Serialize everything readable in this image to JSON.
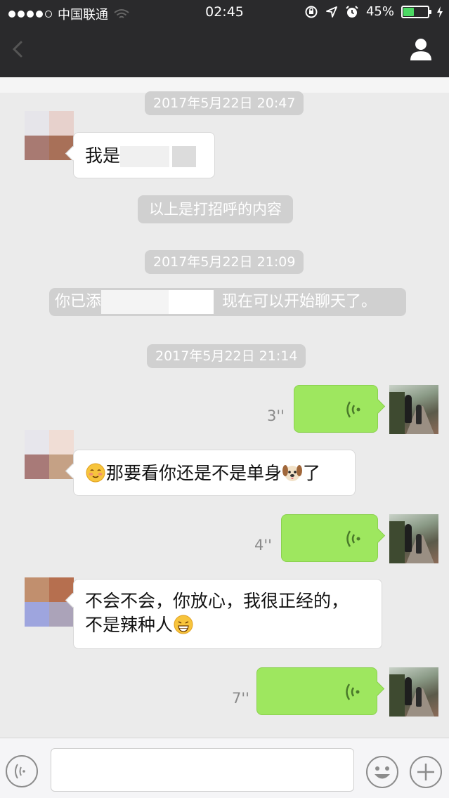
{
  "status_bar": {
    "carrier": "中国联通",
    "time": "02:45",
    "battery": "45%",
    "battery_level": 0.45,
    "battery_color": "#4cd964"
  },
  "nav": {
    "back_icon": "chevron-left-icon",
    "profile_icon": "person-icon"
  },
  "messages": {
    "timestamp1": "2017年5月22日 20:47",
    "msg1_text": "我是",
    "greeting_note": "以上是打招呼的内容",
    "timestamp2": "2017年5月22日 21:09",
    "added_prefix": "你已添",
    "added_suffix": "现在可以开始聊天了。",
    "timestamp3": "2017年5月22日 21:14",
    "voice1_duration": "3''",
    "msg2_text_a": "那要看你还是不是单身",
    "msg2_text_b": "了",
    "voice2_duration": "4''",
    "msg3_line1": "不会不会，你放心，我很正经的，",
    "msg3_line2": "不是辣种人",
    "voice3_duration": "7''"
  },
  "colors": {
    "sent_bubble": "#9ee75f",
    "received_bubble": "#ffffff",
    "header_bg": "#2a2a2c",
    "chat_bg": "#ebebeb"
  },
  "input": {
    "voice_icon": "voice-toggle-icon",
    "emoji_icon": "emoji-icon",
    "plus_icon": "plus-icon"
  }
}
